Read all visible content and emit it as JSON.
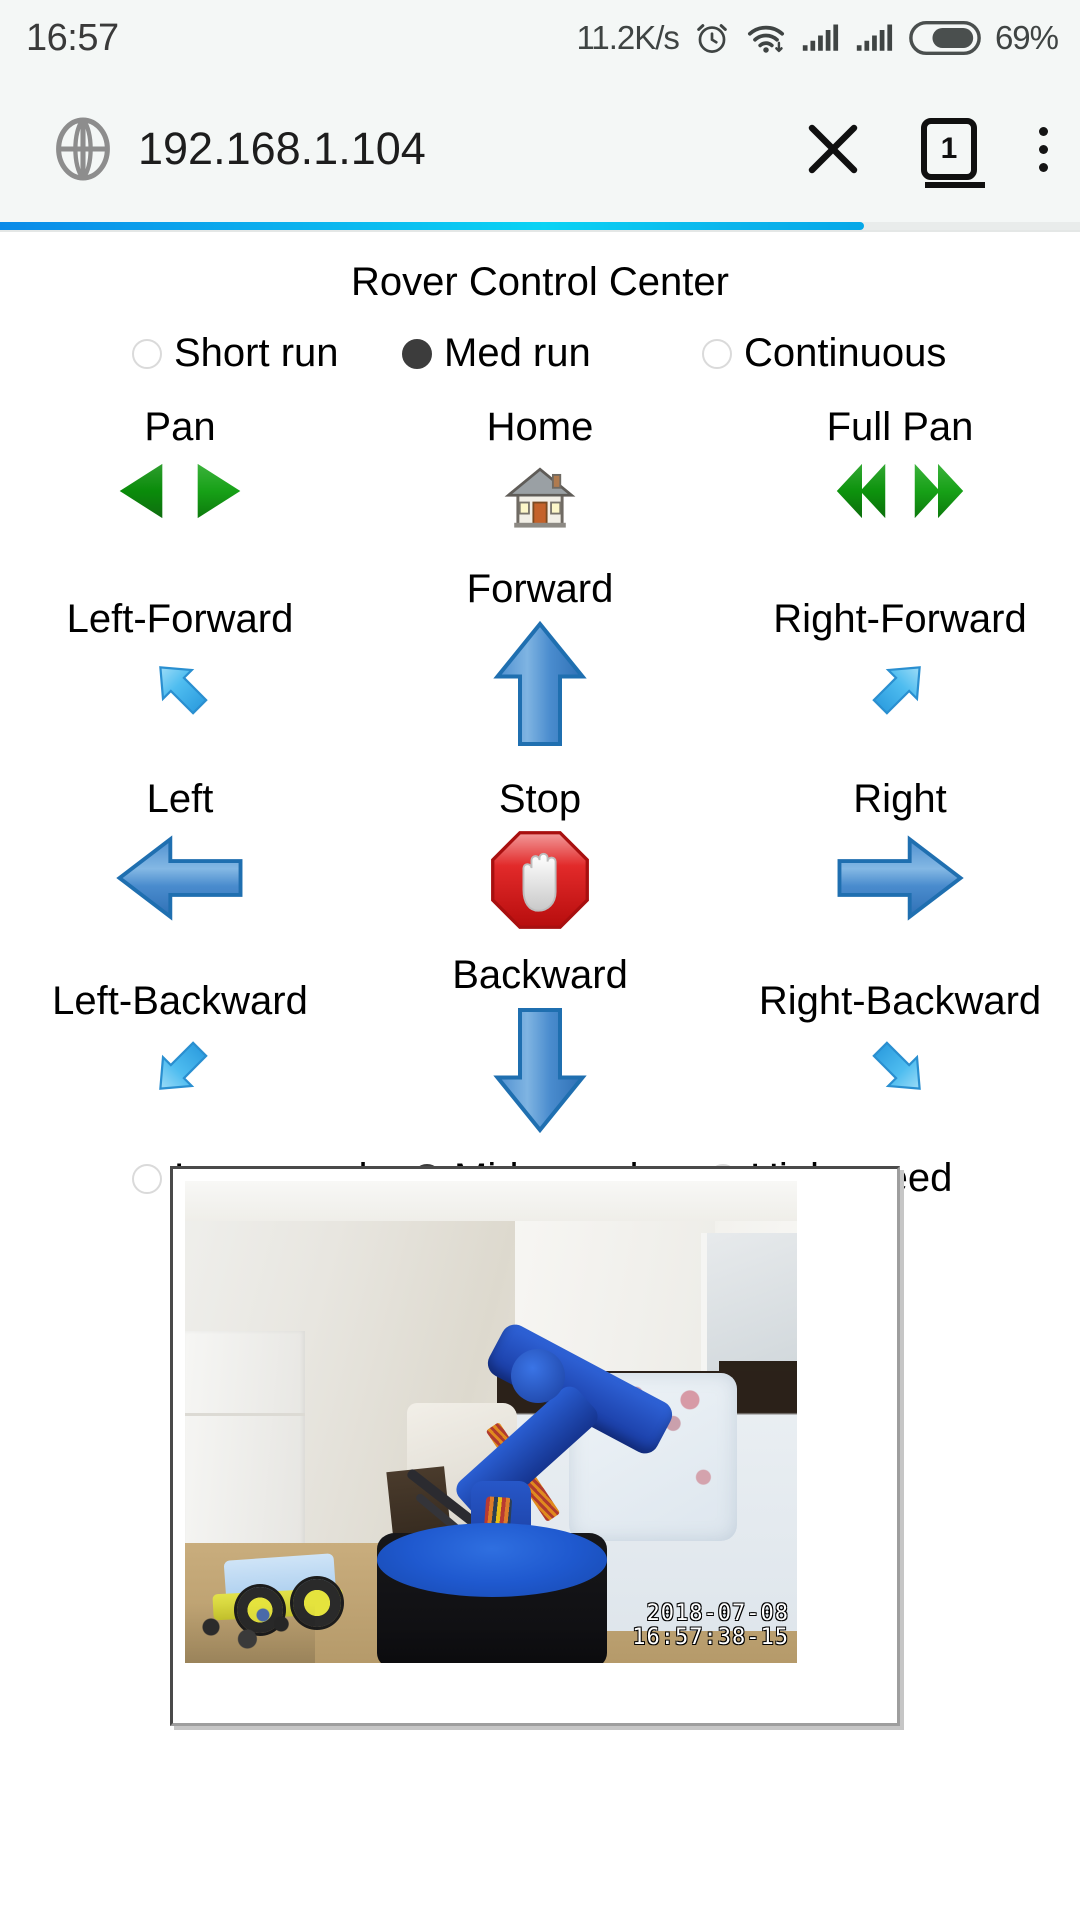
{
  "status_bar": {
    "time": "16:57",
    "network_speed": "11.2K/s",
    "battery_percent": "69%",
    "icons": [
      "alarm-clock-icon",
      "wifi-icon",
      "signal-sim1-icon",
      "signal-sim2-icon",
      "battery-icon"
    ]
  },
  "browser": {
    "url": "192.168.1.104",
    "globe_icon": "globe-icon",
    "stop_icon": "close-icon",
    "tab_count": "1",
    "menu_icon": "kebab-menu-icon",
    "load_progress_percent": 80,
    "progress_color": "#0bb6ef"
  },
  "page": {
    "title": "Rover Control Center",
    "run_modes": [
      {
        "label": "Short run",
        "selected": false
      },
      {
        "label": "Med run",
        "selected": true
      },
      {
        "label": "Continuous",
        "selected": false
      }
    ],
    "pan_row": [
      {
        "label": "Pan",
        "icons": [
          "green-arrow-left-icon",
          "green-arrow-right-icon"
        ]
      },
      {
        "label": "Home",
        "icons": [
          "house-icon"
        ]
      },
      {
        "label": "Full Pan",
        "icons": [
          "green-double-arrow-left-icon",
          "green-double-arrow-right-icon"
        ]
      }
    ],
    "move_grid": [
      {
        "label": "Left-Forward",
        "icon": "arrow-up-left-icon"
      },
      {
        "label": "Forward",
        "icon": "arrow-up-icon"
      },
      {
        "label": "Right-Forward",
        "icon": "arrow-up-right-icon"
      },
      {
        "label": "Left",
        "icon": "arrow-left-icon"
      },
      {
        "label": "Stop",
        "icon": "stop-hand-octagon-icon"
      },
      {
        "label": "Right",
        "icon": "arrow-right-icon"
      },
      {
        "label": "Left-Backward",
        "icon": "arrow-down-left-icon"
      },
      {
        "label": "Backward",
        "icon": "arrow-down-icon"
      },
      {
        "label": "Right-Backward",
        "icon": "arrow-down-right-icon"
      }
    ],
    "speed_modes": [
      {
        "label": "Low speed",
        "selected": false
      },
      {
        "label": "Mid speed",
        "selected": true
      },
      {
        "label": "High speed",
        "selected": false
      }
    ],
    "camera": {
      "timestamp_date": "2018-07-08",
      "timestamp_time": "16:57:38-15"
    },
    "colors": {
      "green_arrow": "#18a31a",
      "blue_arrow": "#3f84c6",
      "light_blue_arrow": "#4fc3f7",
      "stop_red": "#e01b1b"
    }
  }
}
